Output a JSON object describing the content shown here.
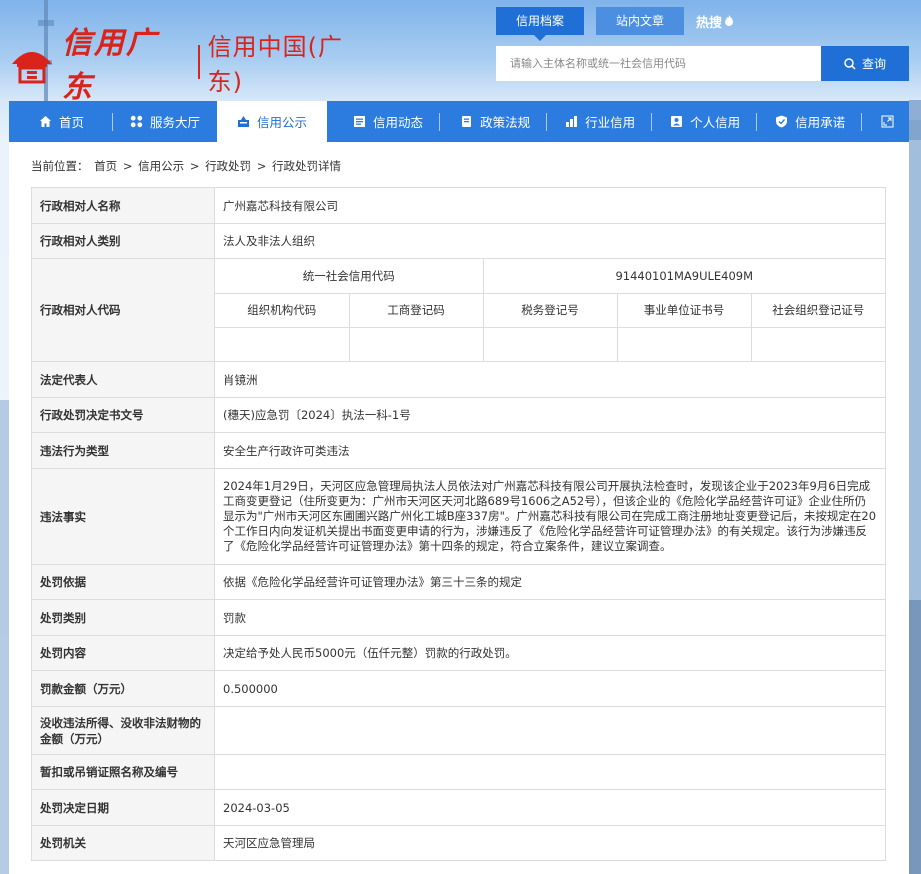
{
  "header": {
    "logo_script": "信用广东",
    "logo_cn": "信用中国(广东)",
    "tabs": [
      "信用档案",
      "站内文章"
    ],
    "hot": "热搜",
    "search_placeholder": "请输入主体名称或统一社会信用代码",
    "search_button": "查询"
  },
  "nav": [
    {
      "label": "首页",
      "icon": "home-icon"
    },
    {
      "label": "服务大厅",
      "icon": "grid-icon"
    },
    {
      "label": "信用公示",
      "icon": "announce-icon"
    },
    {
      "label": "信用动态",
      "icon": "news-icon"
    },
    {
      "label": "政策法规",
      "icon": "book-icon"
    },
    {
      "label": "行业信用",
      "icon": "chart-icon"
    },
    {
      "label": "个人信用",
      "icon": "person-card-icon"
    },
    {
      "label": "信用承诺",
      "icon": "shield-icon"
    }
  ],
  "breadcrumb": [
    "当前位置：",
    "首页",
    ">",
    "信用公示",
    ">",
    "行政处罚",
    ">",
    "行政处罚详情"
  ],
  "detail": {
    "name_label": "行政相对人名称",
    "name": "广州嘉芯科技有限公司",
    "type_label": "行政相对人类别",
    "type": "法人及非法人组织",
    "code_label": "行政相对人代码",
    "code_credit_label": "统一社会信用代码",
    "code_credit": "91440101MA9ULE409M",
    "code_sub_labels": [
      "组织机构代码",
      "工商登记码",
      "税务登记号",
      "事业单位证书号",
      "社会组织登记证号"
    ],
    "legal_rep_label": "法定代表人",
    "legal_rep": "肖镜洲",
    "doc_no_label": "行政处罚决定书文号",
    "doc_no": "(穗天)应急罚〔2024〕执法一科-1号",
    "violation_type_label": "违法行为类型",
    "violation_type": "安全生产行政许可类违法",
    "facts_label": "违法事实",
    "facts": "2024年1月29日，天河区应急管理局执法人员依法对广州嘉芯科技有限公司开展执法检查时，发现该企业于2023年9月6日完成工商变更登记（住所变更为：广州市天河区天河北路689号1606之A52号），但该企业的《危险化学品经营许可证》企业住所仍显示为\"广州市天河区东圃圃兴路广州化工城B座337房\"。广州嘉芯科技有限公司在完成工商注册地址变更登记后，未按规定在20个工作日内向发证机关提出书面变更申请的行为，涉嫌违反了《危险化学品经营许可证管理办法》的有关规定。该行为涉嫌违反了《危险化学品经营许可证管理办法》第十四条的规定，符合立案条件，建议立案调查。",
    "basis_label": "处罚依据",
    "basis": "依据《危险化学品经营许可证管理办法》第三十三条的规定",
    "category_label": "处罚类别",
    "category": "罚款",
    "content_label": "处罚内容",
    "content": "决定给予处人民币5000元（伍仟元整）罚款的行政处罚。",
    "fine_label": "罚款金额（万元）",
    "fine": "0.500000",
    "confiscate_label": "没收违法所得、没收非法财物的金额（万元）",
    "confiscate": "",
    "revoke_label": "暂扣或吊销证照名称及编号",
    "revoke": "",
    "date_label": "处罚决定日期",
    "date": "2024-03-05",
    "authority_label": "处罚机关",
    "authority": "天河区应急管理局"
  }
}
